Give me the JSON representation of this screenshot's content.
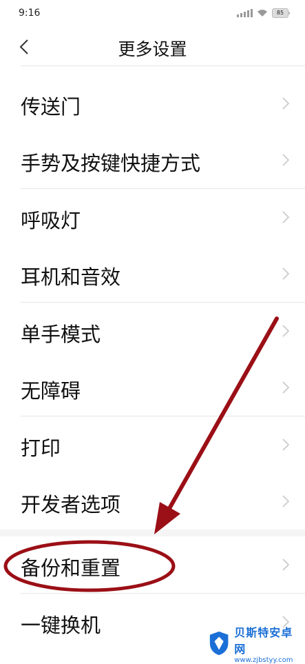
{
  "status_bar": {
    "time": "9:16",
    "battery": "85"
  },
  "header": {
    "title": "更多设置"
  },
  "menu": {
    "items": [
      {
        "label": "传送门"
      },
      {
        "label": "手势及按键快捷方式"
      },
      {
        "label": "呼吸灯"
      },
      {
        "label": "耳机和音效"
      },
      {
        "label": "单手模式"
      },
      {
        "label": "无障碍"
      },
      {
        "label": "打印"
      },
      {
        "label": "开发者选项"
      },
      {
        "label": "备份和重置"
      },
      {
        "label": "一键换机"
      }
    ]
  },
  "annotation": {
    "color": "#9b0f16",
    "highlighted_item": "备份和重置"
  },
  "watermark": {
    "name": "贝斯特安卓网",
    "url": "www.zjbstyy.com",
    "color": "#1b6fd6"
  }
}
